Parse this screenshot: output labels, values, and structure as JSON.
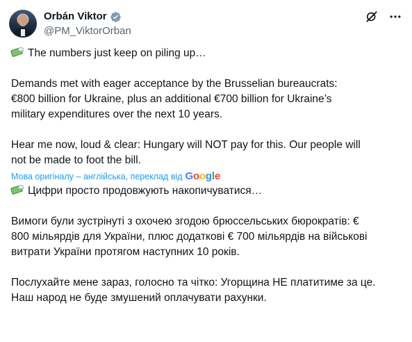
{
  "author": {
    "display_name": "Orbán Viktor",
    "handle": "@PM_ViktorOrban"
  },
  "icons": {
    "verified": "verified-badge-icon",
    "grok": "grok-icon",
    "more": "more-options-icon",
    "money": "money-with-wings-emoji"
  },
  "original": {
    "line1": "The numbers just keep on piling up…",
    "line2": "Demands met with eager acceptance by the Brusselian bureaucrats:\n€800 billion for Ukraine, plus an additional €700 billion for Ukraine’s\nmilitary expenditures over the next 10 years.",
    "line3": "Hear me now, loud & clear: Hungary will NOT pay for this. Our people will\nnot be made to foot the bill."
  },
  "translation_notice": {
    "text": "Мова оригіналу – англійська, переклад від",
    "provider": "Google"
  },
  "translated": {
    "line1": "Цифри просто продовжують накопичуватися…",
    "line2": "Вимоги були зустрінуті з охочею згодою брюссельських бюрократів: €\n800 мільярдів для України, плюс додаткові € 700 мільярдів на військові\nвитрати України протягом наступних 10 років.",
    "line3": "Послухайте мене зараз, голосно та чітко: Угорщина НЕ платитиме за це.\nНаш народ не буде змушений оплачувати рахунки."
  },
  "colors": {
    "link": "#1d9bf0",
    "verified": "#829aab",
    "text": "#0f1419",
    "secondary": "#536471"
  }
}
